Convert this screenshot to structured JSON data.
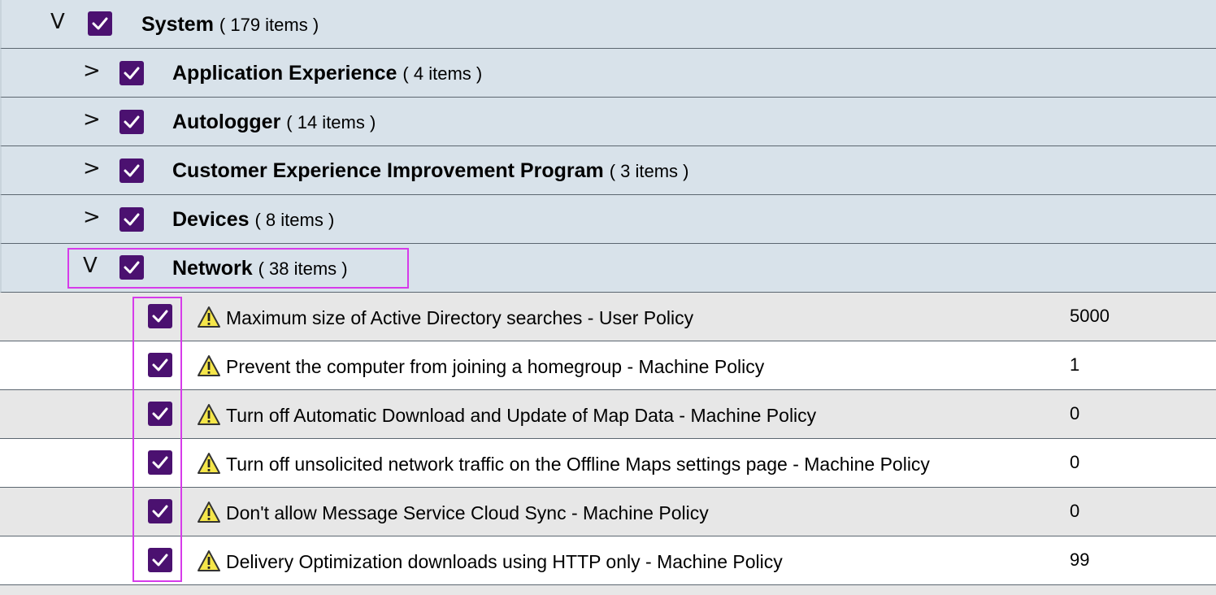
{
  "groups": [
    {
      "name": "System",
      "count": "( 179  items )",
      "expanded": true
    },
    {
      "name": "Application Experience",
      "count": "( 4  items )",
      "expanded": false
    },
    {
      "name": "Autologger",
      "count": "( 14  items )",
      "expanded": false
    },
    {
      "name": "Customer Experience Improvement Program",
      "count": "( 3  items )",
      "expanded": false
    },
    {
      "name": "Devices",
      "count": "( 8  items )",
      "expanded": false
    },
    {
      "name": "Network",
      "count": "( 38  items )",
      "expanded": true
    }
  ],
  "chevrons": {
    "expanded": "V",
    "collapsed": ">"
  },
  "items": [
    {
      "label": "Maximum size of Active Directory searches - User Policy",
      "value": "5000",
      "checked": true
    },
    {
      "label": "Prevent the computer from joining a homegroup - Machine Policy",
      "value": "1",
      "checked": true
    },
    {
      "label": "Turn off Automatic Download and Update of Map Data - Machine Policy",
      "value": "0",
      "checked": true
    },
    {
      "label": "Turn off unsolicited network traffic on the Offline Maps settings page - Machine Policy",
      "value": "0",
      "checked": true
    },
    {
      "label": "Don't allow Message Service Cloud Sync - Machine Policy",
      "value": "0",
      "checked": true
    },
    {
      "label": "Delivery Optimization downloads using HTTP only - Machine Policy",
      "value": "99",
      "checked": true
    }
  ],
  "icons": {
    "checkbox": "checkmark-icon",
    "warning": "warning-triangle-icon"
  },
  "colors": {
    "checkbox": "#4b1170",
    "group_bg": "#d8e2ea",
    "row_alt_bg": "#e7e7e7",
    "highlight": "#d63bea",
    "warning_fill": "#f5e64a"
  }
}
